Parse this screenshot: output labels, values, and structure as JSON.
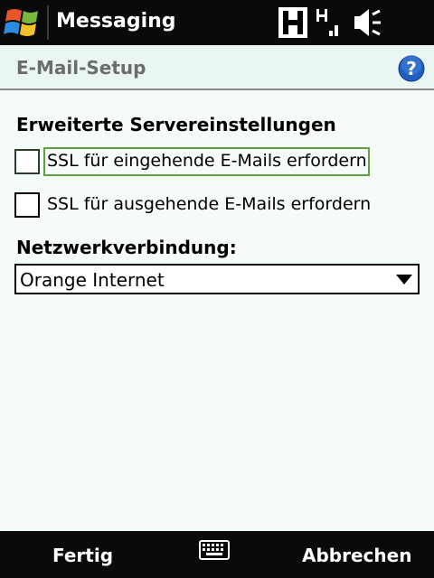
{
  "titlebar": {
    "app_title": "Messaging",
    "icons": {
      "start": "windows-flag-icon",
      "connectivity": "h-data-icon",
      "signal": "signal-icon",
      "volume": "speaker-muted-icon"
    }
  },
  "header": {
    "title": "E-Mail-Setup",
    "help_icon": "help-icon"
  },
  "section": {
    "title": "Erweiterte Servereinstellungen"
  },
  "checkboxes": [
    {
      "label": "SSL für eingehende E-Mails erfordern",
      "checked": false,
      "focused": true
    },
    {
      "label": "SSL für ausgehende E-Mails erfordern",
      "checked": false,
      "focused": false
    }
  ],
  "network": {
    "label": "Netzwerkverbindung:",
    "selected": "Orange Internet"
  },
  "softkeys": {
    "left": "Fertig",
    "right": "Abbrechen",
    "center_icon": "keyboard-icon"
  },
  "colors": {
    "bar": "#0a0a0a",
    "background": "#f4fbf9",
    "focus": "#5fa042",
    "help": "#1f5fbf"
  }
}
